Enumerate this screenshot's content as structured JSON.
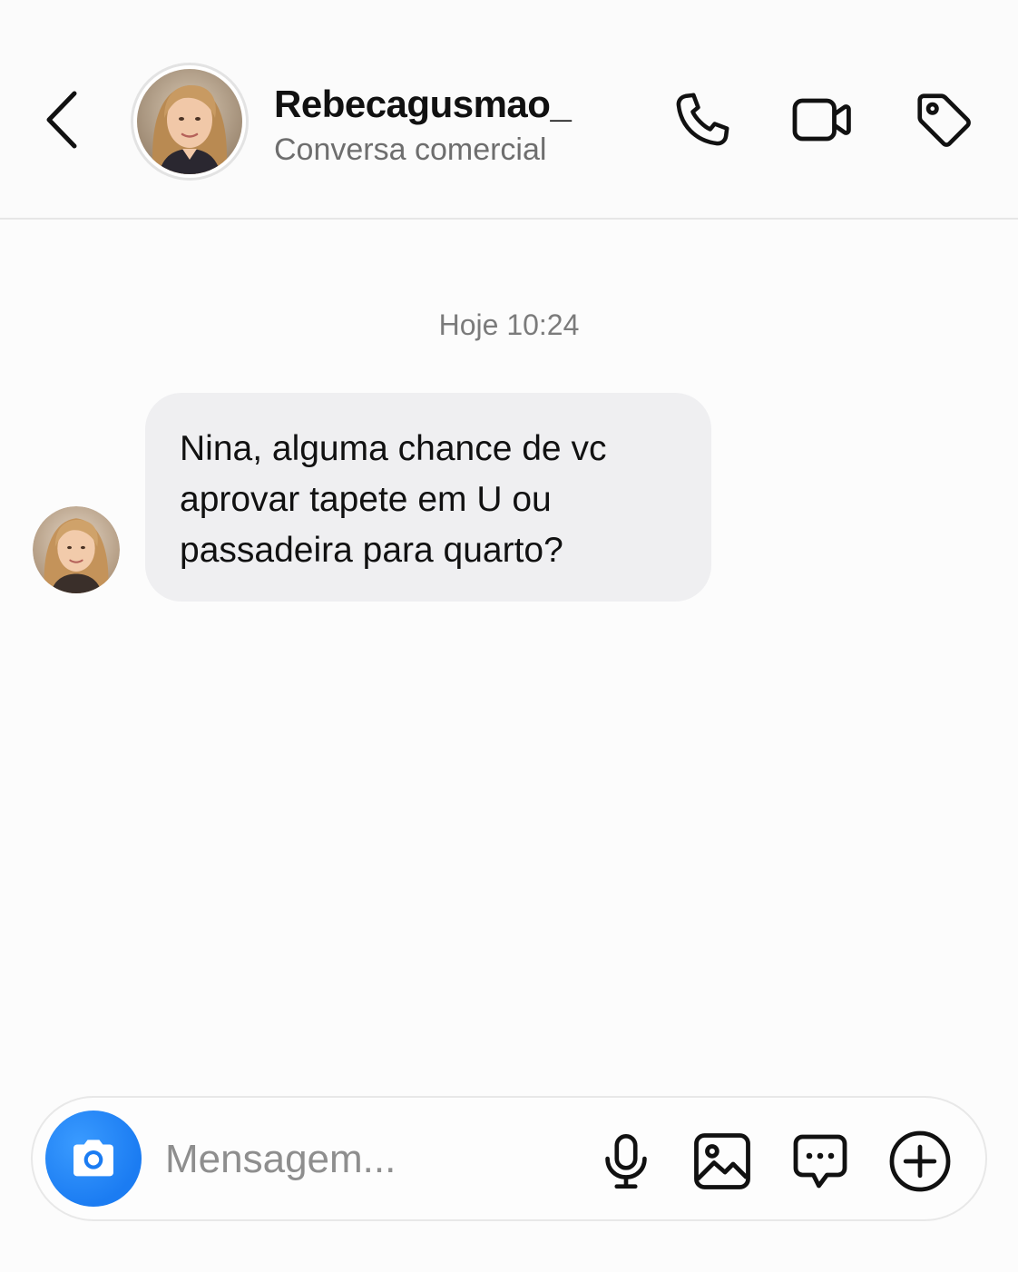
{
  "header": {
    "username": "Rebecagusmao_",
    "subtitle": "Conversa comercial",
    "icons": [
      "back-chevron-icon",
      "phone-icon",
      "video-camera-icon",
      "tag-icon"
    ]
  },
  "chat": {
    "timestamp": "Hoje 10:24",
    "messages": [
      {
        "sender": "Rebecagusmao_",
        "text": "Nina, alguma chance de vc\naprovar tapete em U ou\npassadeira para quarto?"
      }
    ]
  },
  "composer": {
    "placeholder": "Mensagem...",
    "value": "",
    "icons": [
      "camera-icon",
      "microphone-icon",
      "image-icon",
      "message-dots-icon",
      "plus-circle-icon"
    ]
  },
  "colors": {
    "accent": "#1b7cf2",
    "bubble": "#efeff1",
    "background": "#fcfcfc",
    "muted_text": "#6e6e6e"
  }
}
